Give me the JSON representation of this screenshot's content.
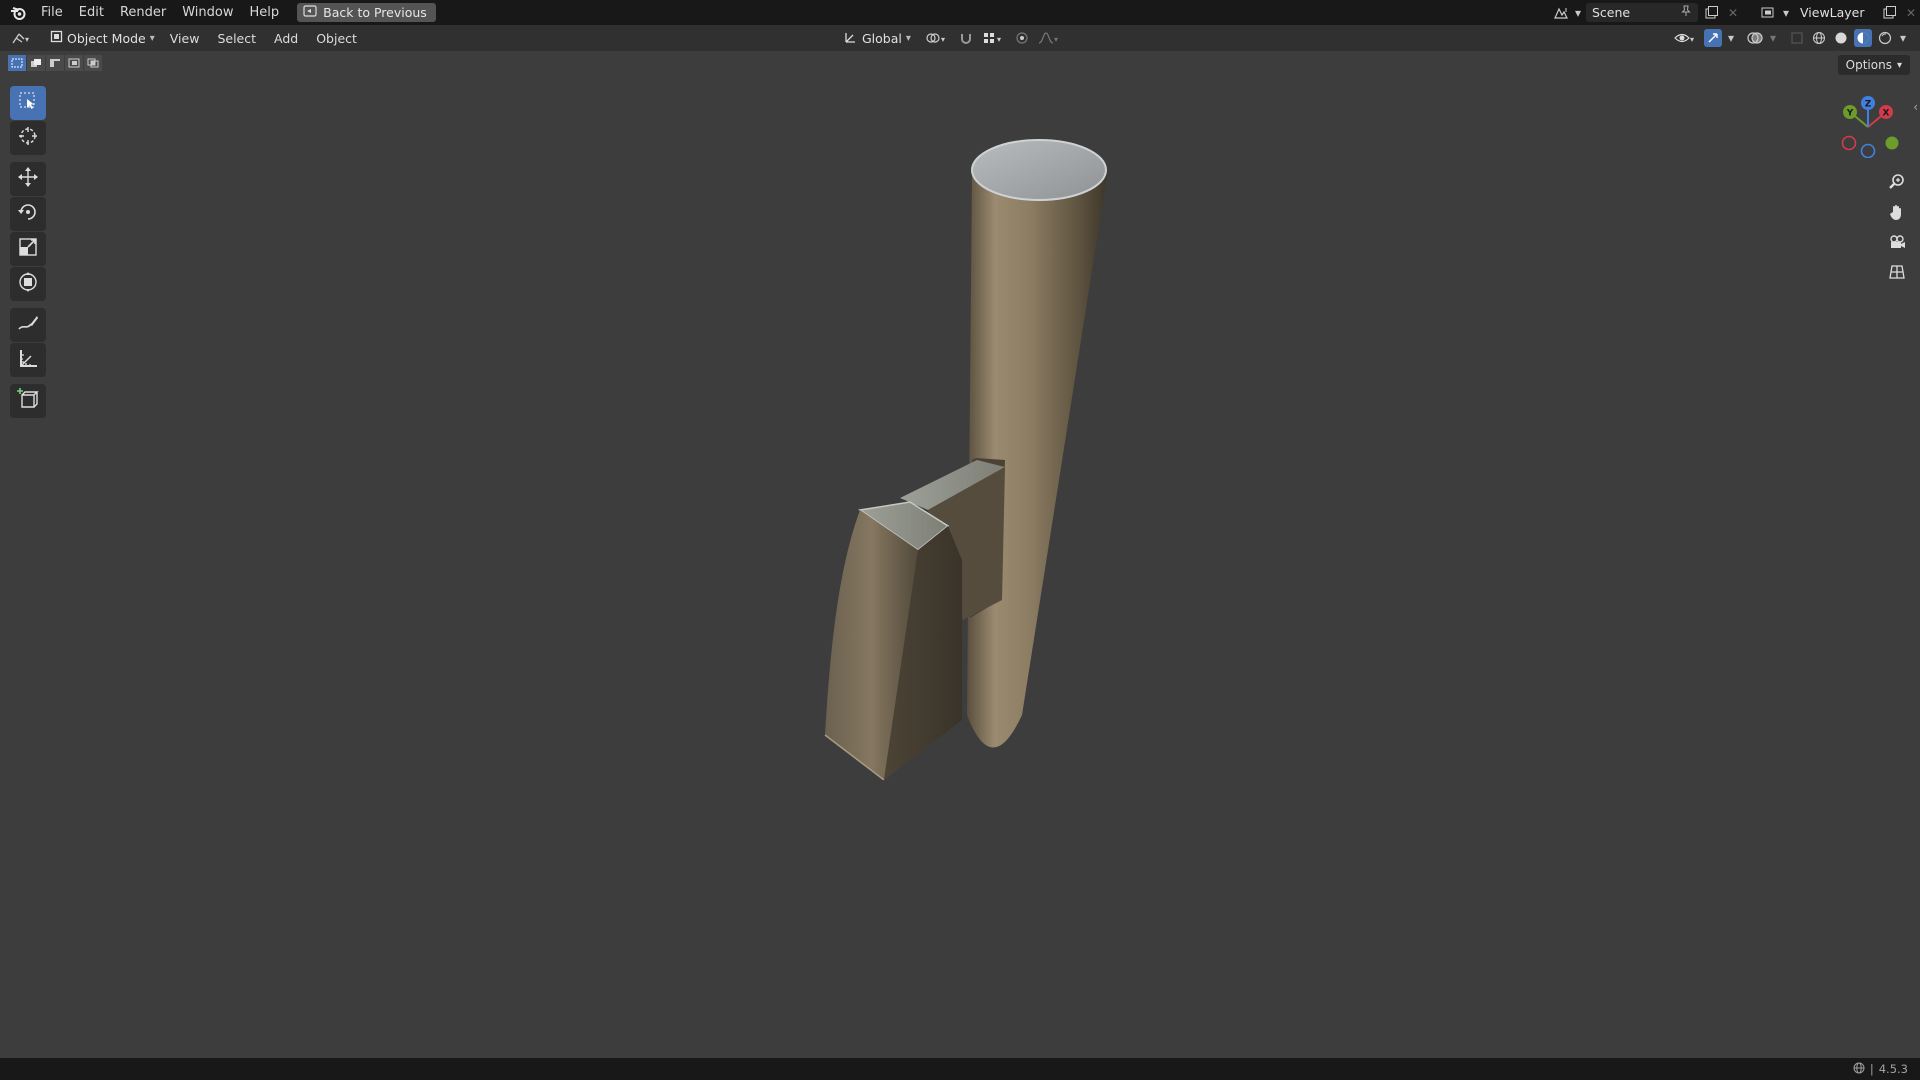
{
  "menu": {
    "items": [
      "File",
      "Edit",
      "Render",
      "Window",
      "Help"
    ],
    "back_label": "Back to Previous"
  },
  "top_right": {
    "scene_name": "Scene",
    "view_layer": "ViewLayer"
  },
  "header": {
    "mode": "Object Mode",
    "menus": [
      "View",
      "Select",
      "Add",
      "Object"
    ],
    "orientation": "Global"
  },
  "viewport": {
    "options_label": "Options",
    "gizmo": {
      "x": "X",
      "y": "Y",
      "z": "Z"
    }
  },
  "toolbar": {
    "tools": [
      "select-box",
      "cursor",
      "move",
      "rotate",
      "scale",
      "transform",
      "annotate",
      "measure",
      "add-cube"
    ],
    "active": "select-box"
  },
  "status": {
    "version": "4.5.3"
  },
  "colors": {
    "accent": "#4772b3",
    "viewport_bg": "#3d3d3d",
    "axis_x": "#d13b4c",
    "axis_y": "#6c9c2c",
    "axis_z": "#3f80e0"
  }
}
